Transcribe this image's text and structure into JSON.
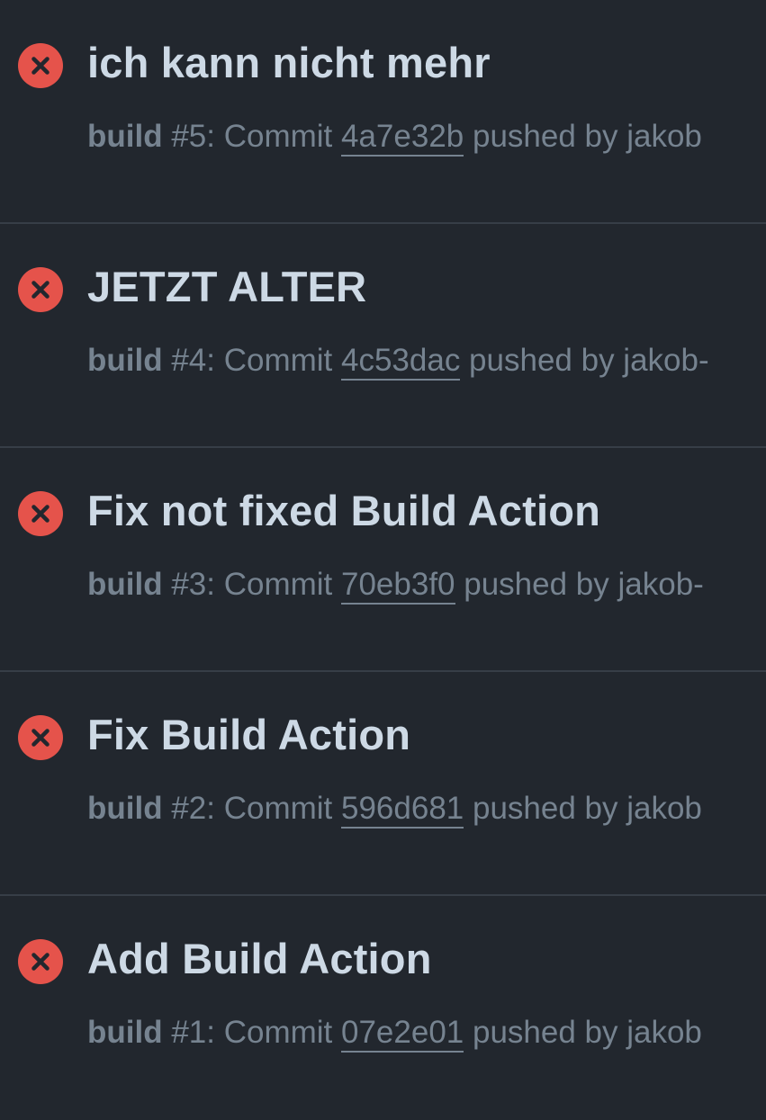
{
  "colors": {
    "background": "#22272e",
    "failure": "#e5534b",
    "title": "#cdd9e5",
    "meta": "#768390",
    "divider": "#373e47"
  },
  "runs": [
    {
      "status_icon": "x-circle-fill-icon",
      "title": "ich kann nicht mehr",
      "workflow": "build",
      "number_text": "#5",
      "commit_prefix": ": Commit ",
      "sha": "4a7e32b",
      "pushed_text": " pushed by jakob"
    },
    {
      "status_icon": "x-circle-fill-icon",
      "title": "JETZT ALTER",
      "workflow": "build",
      "number_text": "#4",
      "commit_prefix": ": Commit ",
      "sha": "4c53dac",
      "pushed_text": " pushed by jakob-"
    },
    {
      "status_icon": "x-circle-fill-icon",
      "title": "Fix not fixed Build Action",
      "workflow": "build",
      "number_text": "#3",
      "commit_prefix": ": Commit ",
      "sha": "70eb3f0",
      "pushed_text": " pushed by jakob-"
    },
    {
      "status_icon": "x-circle-fill-icon",
      "title": "Fix Build Action",
      "workflow": "build",
      "number_text": "#2",
      "commit_prefix": ": Commit ",
      "sha": "596d681",
      "pushed_text": " pushed by jakob"
    },
    {
      "status_icon": "x-circle-fill-icon",
      "title": "Add Build Action",
      "workflow": "build",
      "number_text": "#1",
      "commit_prefix": ": Commit ",
      "sha": "07e2e01",
      "pushed_text": " pushed by jakob"
    }
  ]
}
